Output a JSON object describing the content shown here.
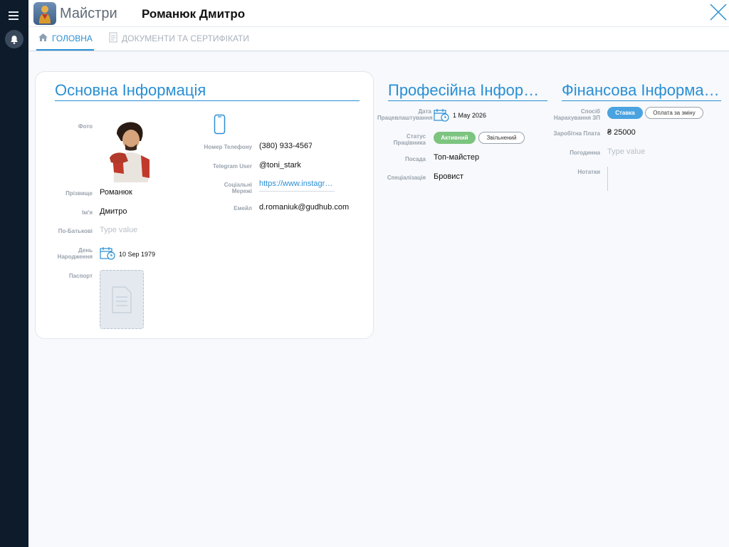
{
  "header": {
    "app_name": "Майстри",
    "title": "Романюк Дмитро"
  },
  "tabs": [
    {
      "label": "ГОЛОВНА"
    },
    {
      "label": "ДОКУМЕНТИ ТА СЕРТИФІКАТИ"
    }
  ],
  "basic": {
    "title": "Основна Інформація",
    "photo_label": "Фото",
    "surname_label": "Прізвище",
    "surname": "Романюк",
    "name_label": "Ім'я",
    "name": "Дмитро",
    "patronymic_label": "По-Батькові",
    "patronymic_placeholder": "Type value",
    "birthday_label": "День Народження",
    "birthday": "10 Sep 1979",
    "passport_label": "Паспорт",
    "phone_label": "Номер Телефону",
    "phone": "(380) 933-4567",
    "telegram_label": "Telegram User",
    "telegram": "@toni_stark",
    "social_label": "Соціальні Мережі",
    "social": "https://www.instagram.com/",
    "email_label": "Емейл",
    "email": "d.romaniuk@gudhub.com"
  },
  "professional": {
    "title": "Професійна Інформація",
    "hire_date_label": "Дата Працевлаштування",
    "hire_date": "1 May 2026",
    "status_label": "Статус Працівника",
    "status_options": [
      "Активний",
      "Звільнений"
    ],
    "position_label": "Посада",
    "position": "Топ-майстер",
    "specialization_label": "Спеціалізація",
    "specialization": "Бровист"
  },
  "financial": {
    "title": "Фінансова Інформація",
    "pay_method_label": "Спосіб Нарахування ЗП",
    "pay_options": [
      "Ставка",
      "Оплата за зміну"
    ],
    "salary_label": "Заробітна Плата",
    "salary": "₴ 25000",
    "hourly_label": "Погодинна",
    "hourly_placeholder": "Type value",
    "notes_label": "Нотатки"
  },
  "colors": {
    "accent": "#2a8fd4",
    "active": "#7cc47f",
    "sidebar": "#0d1b2a"
  }
}
